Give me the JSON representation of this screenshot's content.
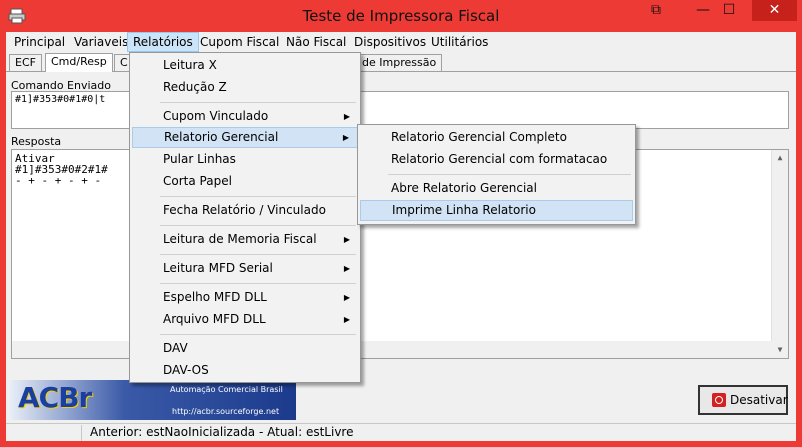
{
  "window": {
    "title": "Teste de Impressora Fiscal"
  },
  "menubar": [
    "Principal",
    "Variaveis",
    "Relatórios",
    "Cupom Fiscal",
    "Não Fiscal",
    "Dispositivos",
    "Utilitários"
  ],
  "tabs": {
    "ecf": "ECF",
    "cmd": "Cmd/Resp",
    "partial": "C",
    "tail": "de Impressão"
  },
  "labels": {
    "comando": "Comando Enviado",
    "resposta": "Resposta"
  },
  "comando_text": "#1]#353#0#1#0|t",
  "resposta_lines": [
    "Ativar",
    "#1]#353#0#2#1#",
    "- + - + - + -"
  ],
  "relatorios_menu": [
    "Leitura X",
    "Redução Z",
    "Cupom Vinculado",
    "Relatorio Gerencial",
    "Pular Linhas",
    "Corta Papel",
    "Fecha Relatório / Vinculado",
    "Leitura de Memoria Fiscal",
    "Leitura MFD Serial",
    "Espelho MFD DLL",
    "Arquivo MFD DLL",
    "DAV",
    "DAV-OS"
  ],
  "gerencial_submenu": [
    "Relatorio Gerencial Completo",
    "Relatorio Gerencial com formatacao",
    "Abre Relatorio Gerencial",
    "Imprime Linha Relatorio"
  ],
  "banner": {
    "logo": "ACBr",
    "tagline": "Automação Comercial Brasil",
    "url": "http://acbr.sourceforge.net"
  },
  "buttons": {
    "desativar": "Desativar"
  },
  "status": "Anterior: estNaoInicializada - Atual: estLivre",
  "colors": {
    "titlebar": "#ee3a34",
    "close": "#c7211c",
    "highlight": "#d1e3f4"
  }
}
